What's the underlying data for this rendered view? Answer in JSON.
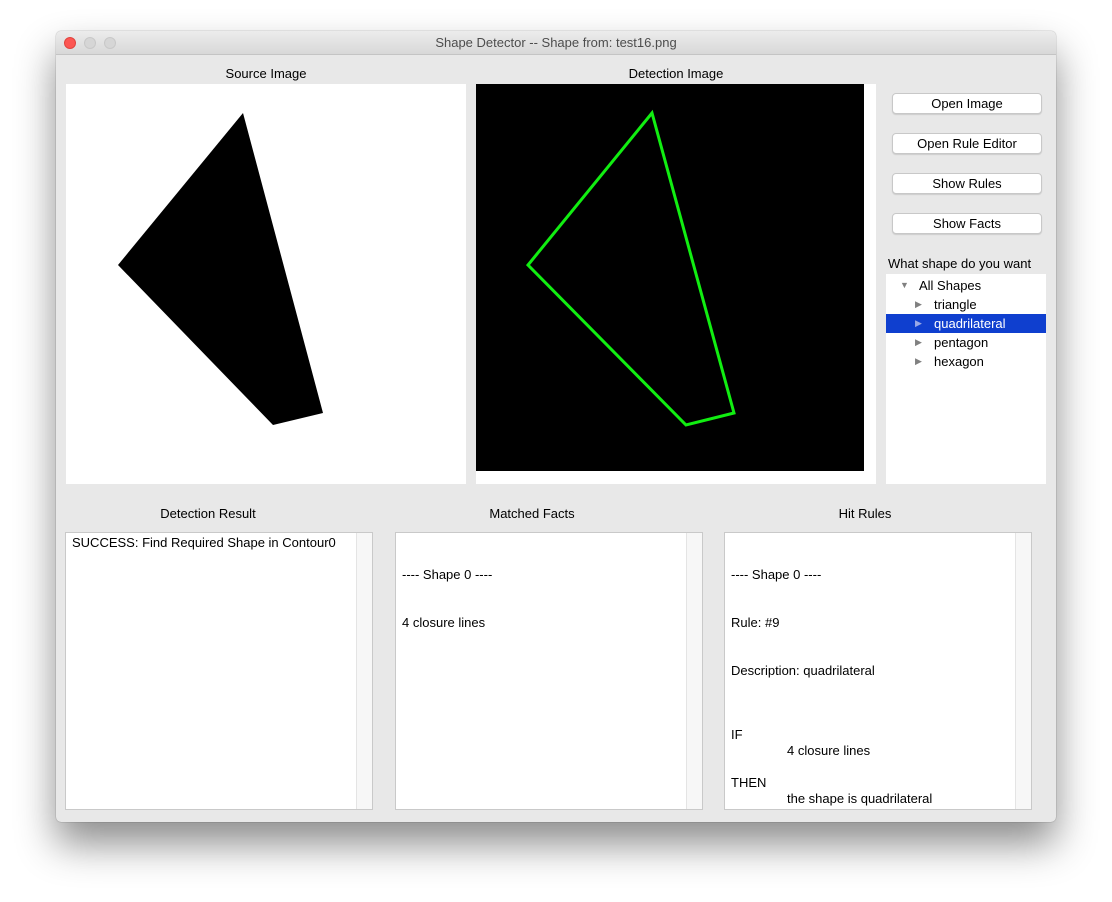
{
  "window": {
    "title": "Shape Detector -- Shape from: test16.png"
  },
  "labels": {
    "source_image": "Source Image",
    "detection_image": "Detection Image",
    "shape_prompt": "What shape do you want",
    "detection_result": "Detection Result",
    "matched_facts": "Matched Facts",
    "hit_rules": "Hit Rules"
  },
  "buttons": {
    "open_image": "Open Image",
    "open_rule_editor": "Open Rule Editor",
    "show_rules": "Show Rules",
    "show_facts": "Show Facts"
  },
  "shape_tree": {
    "root": {
      "label": "All Shapes",
      "expanded": true
    },
    "items": [
      {
        "label": "triangle",
        "selected": false
      },
      {
        "label": "quadrilateral",
        "selected": true
      },
      {
        "label": "pentagon",
        "selected": false
      },
      {
        "label": "hexagon",
        "selected": false
      }
    ]
  },
  "detection_result": {
    "lines": [
      "SUCCESS: Find Required Shape in Contour0"
    ]
  },
  "matched_facts": {
    "lines": [
      "---- Shape 0 ----",
      "4 closure lines"
    ]
  },
  "hit_rules": {
    "header": "---- Shape 0 ----",
    "rule": "Rule: #9",
    "description": "Description: quadrilateral",
    "if_key": "IF",
    "if_val": "4 closure lines",
    "then_key": "THEN",
    "then_val": "the shape is quadrilateral"
  },
  "colors": {
    "detection_outline": "#11ee11",
    "selection": "#0f3fcf",
    "close_button": "#fc5652"
  }
}
